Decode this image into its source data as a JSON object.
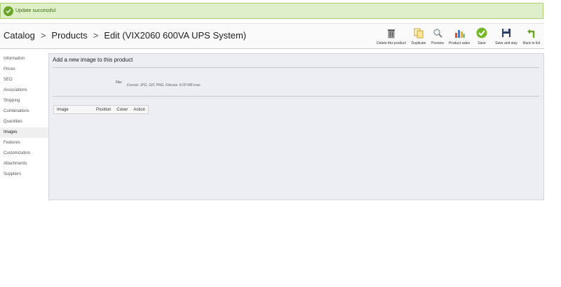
{
  "notice": {
    "message": "Update successful"
  },
  "breadcrumb": {
    "items": [
      "Catalog",
      "Products",
      "Edit (VIX2060 600VA UPS System)"
    ]
  },
  "toolbar": {
    "buttons": [
      {
        "label": "Delete this product",
        "icon": "trash-icon"
      },
      {
        "label": "Duplicate",
        "icon": "duplicate-icon"
      },
      {
        "label": "Preview",
        "icon": "preview-icon"
      },
      {
        "label": "Product sales",
        "icon": "sales-chart-icon"
      },
      {
        "label": "Save",
        "icon": "save-check-icon"
      },
      {
        "label": "Save and stay",
        "icon": "floppy-icon"
      },
      {
        "label": "Back to list",
        "icon": "back-arrow-icon"
      }
    ]
  },
  "sidebar": {
    "items": [
      {
        "label": "Information"
      },
      {
        "label": "Prices"
      },
      {
        "label": "SEO"
      },
      {
        "label": "Associations"
      },
      {
        "label": "Shipping"
      },
      {
        "label": "Combinations"
      },
      {
        "label": "Quantities"
      },
      {
        "label": "Images"
      },
      {
        "label": "Features"
      },
      {
        "label": "Customization"
      },
      {
        "label": "Attachments"
      },
      {
        "label": "Suppliers"
      }
    ],
    "active": "Images"
  },
  "panel": {
    "title": "Add a new image to this product",
    "file_label": "File:",
    "file_hint": "Format: JPG, GIF, PNG. Filesize: 8.00 MB max.",
    "table_headers": [
      "Image",
      "Position",
      "Cover",
      "Action"
    ]
  },
  "colors": {
    "notice_bg": "#dff0c8",
    "panel_bg": "#eceef3",
    "accent_green": "#6aa52a"
  }
}
